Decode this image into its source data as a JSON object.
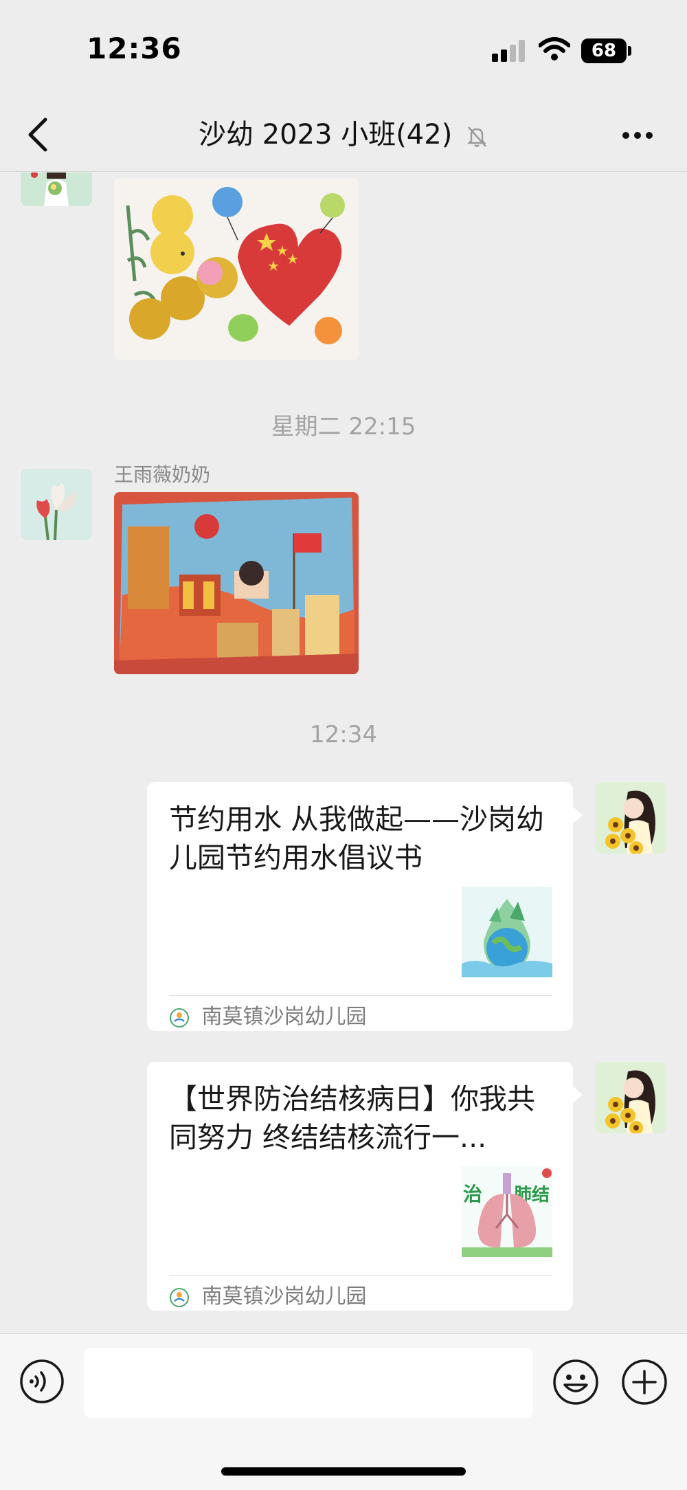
{
  "status_bar": {
    "time": "12:36",
    "battery": "68"
  },
  "header": {
    "title": "沙幼 2023 小班(42)"
  },
  "messages": {
    "timestamp_1": "星期二 22:15",
    "sender_2": "王雨薇奶奶",
    "timestamp_2": "12:34",
    "card_1": {
      "title": "节约用水 从我做起——沙岗幼儿园节约用水倡议书",
      "source": "南莫镇沙岗幼儿园"
    },
    "card_2": {
      "title": "【世界防治结核病日】你我共同努力 终结结核流行一...",
      "source": "南莫镇沙岗幼儿园"
    },
    "card_2_thumb_text": [
      "治",
      "肺结"
    ]
  },
  "colors": {
    "background": "#ededed",
    "card": "#ffffff",
    "secondary_text": "#888888"
  },
  "icons": [
    "back-arrow-icon",
    "mute-bell-icon",
    "more-icon",
    "voice-icon",
    "emoji-icon",
    "plus-icon",
    "signal-icon",
    "wifi-icon",
    "battery-icon"
  ]
}
